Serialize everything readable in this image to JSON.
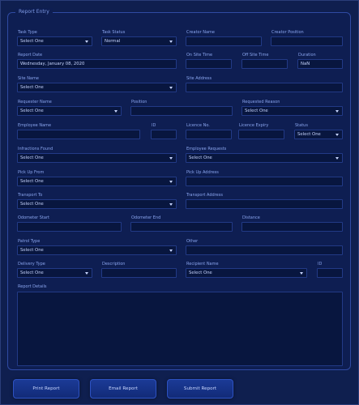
{
  "legend": "Report Entry",
  "labels": {
    "task_type": "Task Type",
    "task_status": "Task Status",
    "creator_name": "Creator Name",
    "creator_position": "Creator Position",
    "report_date": "Report Date",
    "on_site_time": "On Site Time",
    "off_site_time": "Off Site Time",
    "duration": "Duration",
    "site_name": "Site Name",
    "site_address": "Site Address",
    "requester_name": "Requester Name",
    "position": "Position",
    "requested_reason": "Requested Reason",
    "employee_name": "Employee Name",
    "id": "ID",
    "licence_no": "Licence No.",
    "licence_expiry": "Licence Expiry",
    "status": "Status",
    "infractions_found": "Infractions Found",
    "employee_requests": "Employee Requests",
    "pick_up_from": "Pick Up From",
    "pick_up_address": "Pick Up Address",
    "transport_to": "Transport To",
    "transport_address": "Transport Address",
    "odometer_start": "Odometer Start",
    "odometer_end": "Odometer End",
    "distance": "Distance",
    "patrol_type": "Patrol Type",
    "other": "Other",
    "delivery_type": "Delivery Type",
    "description": "Description",
    "recipient_name": "Recipient Name",
    "recipient_id": "ID",
    "report_details": "Report Details"
  },
  "values": {
    "task_type": "Select One",
    "task_status": "Normal",
    "creator_name": "",
    "creator_position": "",
    "report_date": "Wednesday, January 08, 2020",
    "on_site_time": "",
    "off_site_time": "",
    "duration": "NaN",
    "site_name": "Select One",
    "site_address": "",
    "requester_name": "Select One",
    "position": "",
    "requested_reason": "Select One",
    "employee_name": "",
    "id": "",
    "licence_no": "",
    "licence_expiry": "",
    "status": "Select One",
    "infractions_found": "Select One",
    "employee_requests": "Select One",
    "pick_up_from": "Select One",
    "pick_up_address": "",
    "transport_to": "Select One",
    "transport_address": "",
    "odometer_start": "",
    "odometer_end": "",
    "distance": "",
    "patrol_type": "Select One",
    "other": "",
    "delivery_type": "Select One",
    "description": "",
    "recipient_name": "Select One",
    "recipient_id": "",
    "report_details": ""
  },
  "buttons": {
    "print": "Print Report",
    "email": "Email Report",
    "submit": "Submit Report"
  }
}
